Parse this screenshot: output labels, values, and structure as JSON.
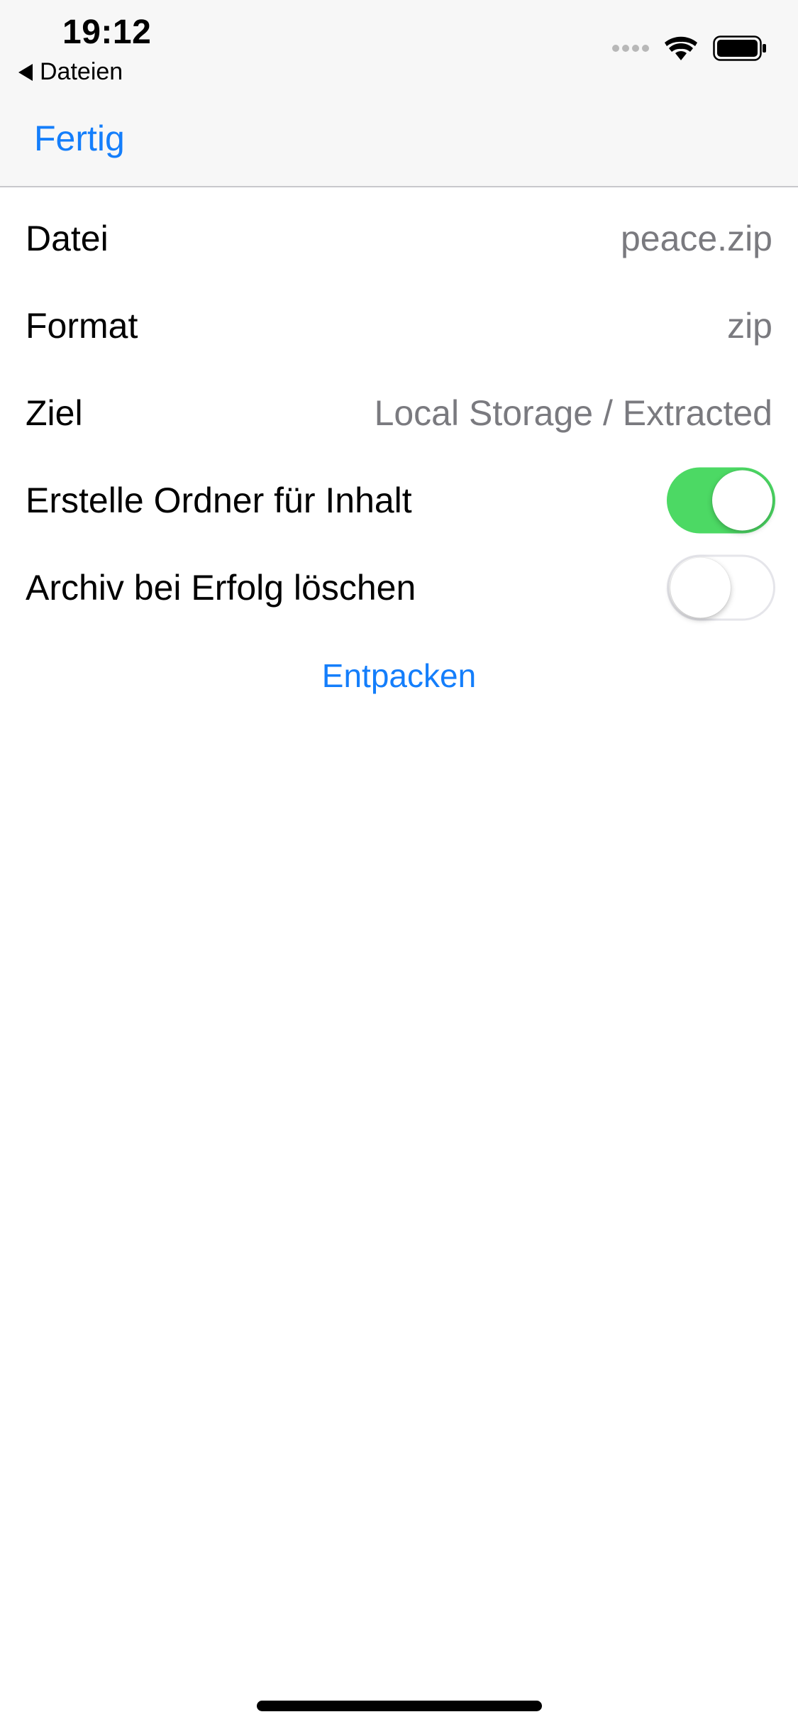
{
  "status_bar": {
    "time": "19:12",
    "back_app_label": "Dateien"
  },
  "nav": {
    "done_label": "Fertig"
  },
  "rows": [
    {
      "label": "Datei",
      "value": "peace.zip"
    },
    {
      "label": "Format",
      "value": "zip"
    },
    {
      "label": "Ziel",
      "value": "Local Storage / Extracted"
    }
  ],
  "toggles": [
    {
      "label": "Erstelle Ordner für Inhalt",
      "on": true
    },
    {
      "label": "Archiv bei Erfolg löschen",
      "on": false
    }
  ],
  "action": {
    "label": "Entpacken"
  },
  "colors": {
    "accent": "#147efb",
    "toggle_on": "#4cd964",
    "secondary_text": "#7a7a7f"
  }
}
